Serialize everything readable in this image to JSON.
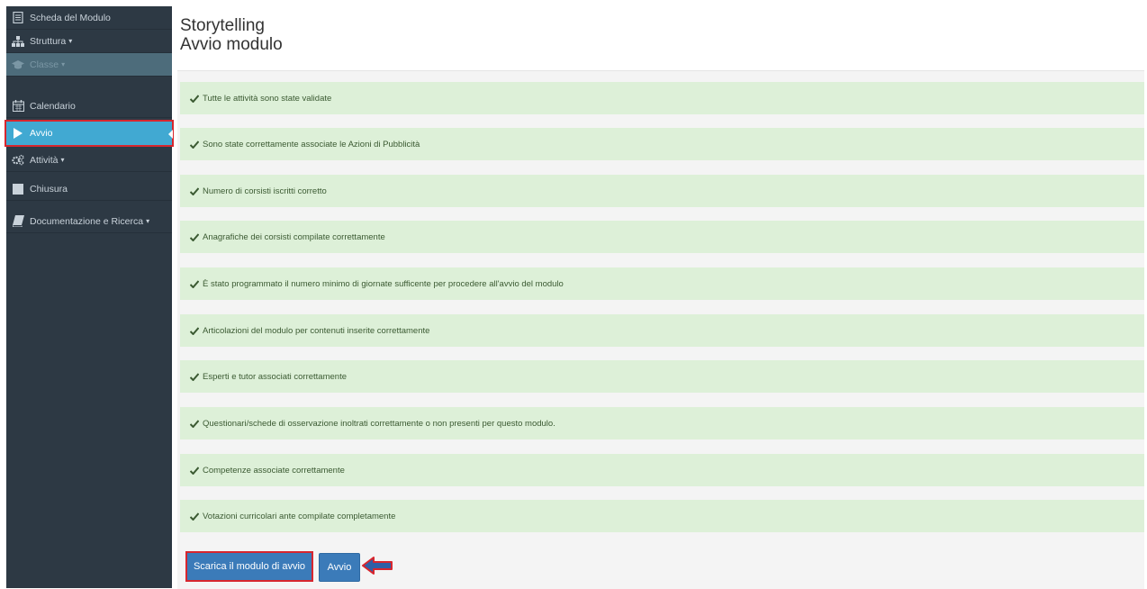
{
  "sidebar": {
    "items": [
      {
        "label": "Scheda del Modulo",
        "icon": "document-icon"
      },
      {
        "label": "Struttura",
        "icon": "sitemap-icon",
        "caret": "▾"
      },
      {
        "label": "Classe",
        "icon": "graduation-cap-icon",
        "caret": "▾"
      },
      {
        "label": "Calendario",
        "icon": "calendar-icon"
      },
      {
        "label": "Avvio",
        "icon": "play-icon"
      },
      {
        "label": "Attività",
        "icon": "cogs-icon",
        "caret": "▾"
      },
      {
        "label": "Chiusura",
        "icon": "square-icon"
      },
      {
        "label": "Documentazione e Ricerca",
        "icon": "book-icon",
        "caret": "▾"
      }
    ]
  },
  "header": {
    "title": "Storytelling",
    "subtitle": "Avvio modulo"
  },
  "checks": [
    "Tutte le attività sono state validate",
    "Sono state correttamente associate le Azioni di Pubblicità",
    "Numero di corsisti iscritti corretto",
    "Anagrafiche dei corsisti compilate correttamente",
    "È stato programmato il numero minimo di giornate sufficente per procedere all'avvio del modulo",
    "Articolazioni del modulo per contenuti inserite correttamente",
    "Esperti e tutor associati correttamente",
    "Questionari/schede di osservazione inoltrati correttamente o non presenti per questo modulo.",
    "Competenze associate correttamente",
    "Votazioni curricolari ante compilate completamente"
  ],
  "buttons": {
    "download_label": "Scarica il modulo di avvio",
    "start_label": "Avvio"
  },
  "colors": {
    "sidebar_bg": "#2d3944",
    "active_item": "#41a9d2",
    "highlight_border": "#d7262e",
    "success_bg": "#ddf0d8",
    "button_bg": "#3b7bb9"
  }
}
